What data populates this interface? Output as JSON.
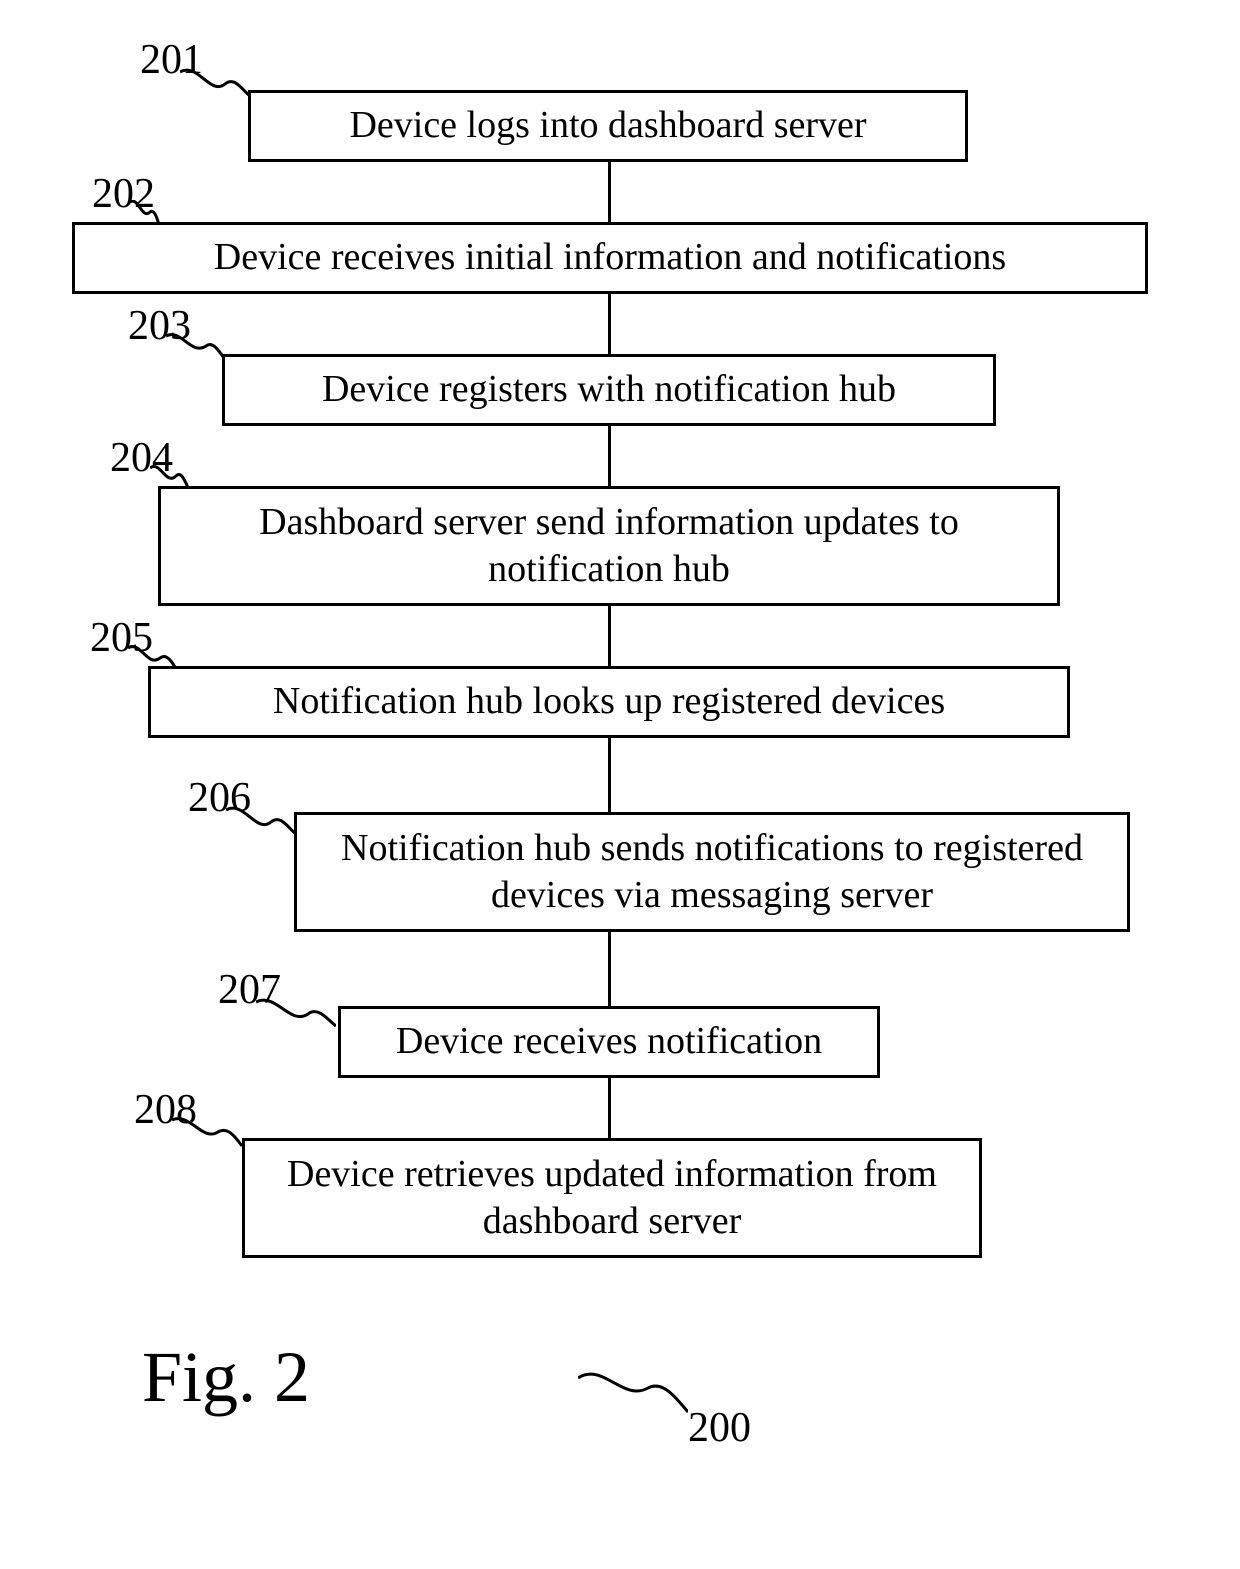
{
  "figure": {
    "title": "Fig. 2",
    "id_label": "200"
  },
  "steps": [
    {
      "num": "201",
      "text": "Device logs into dashboard server"
    },
    {
      "num": "202",
      "text": "Device receives initial information and notifications"
    },
    {
      "num": "203",
      "text": "Device registers with notification hub"
    },
    {
      "num": "204",
      "text": "Dashboard server send information updates to notification hub"
    },
    {
      "num": "205",
      "text": "Notification hub looks up registered devices"
    },
    {
      "num": "206",
      "text": "Notification hub sends notifications to registered devices via messaging server"
    },
    {
      "num": "207",
      "text": "Device receives notification"
    },
    {
      "num": "208",
      "text": "Device retrieves updated information from dashboard server"
    }
  ]
}
